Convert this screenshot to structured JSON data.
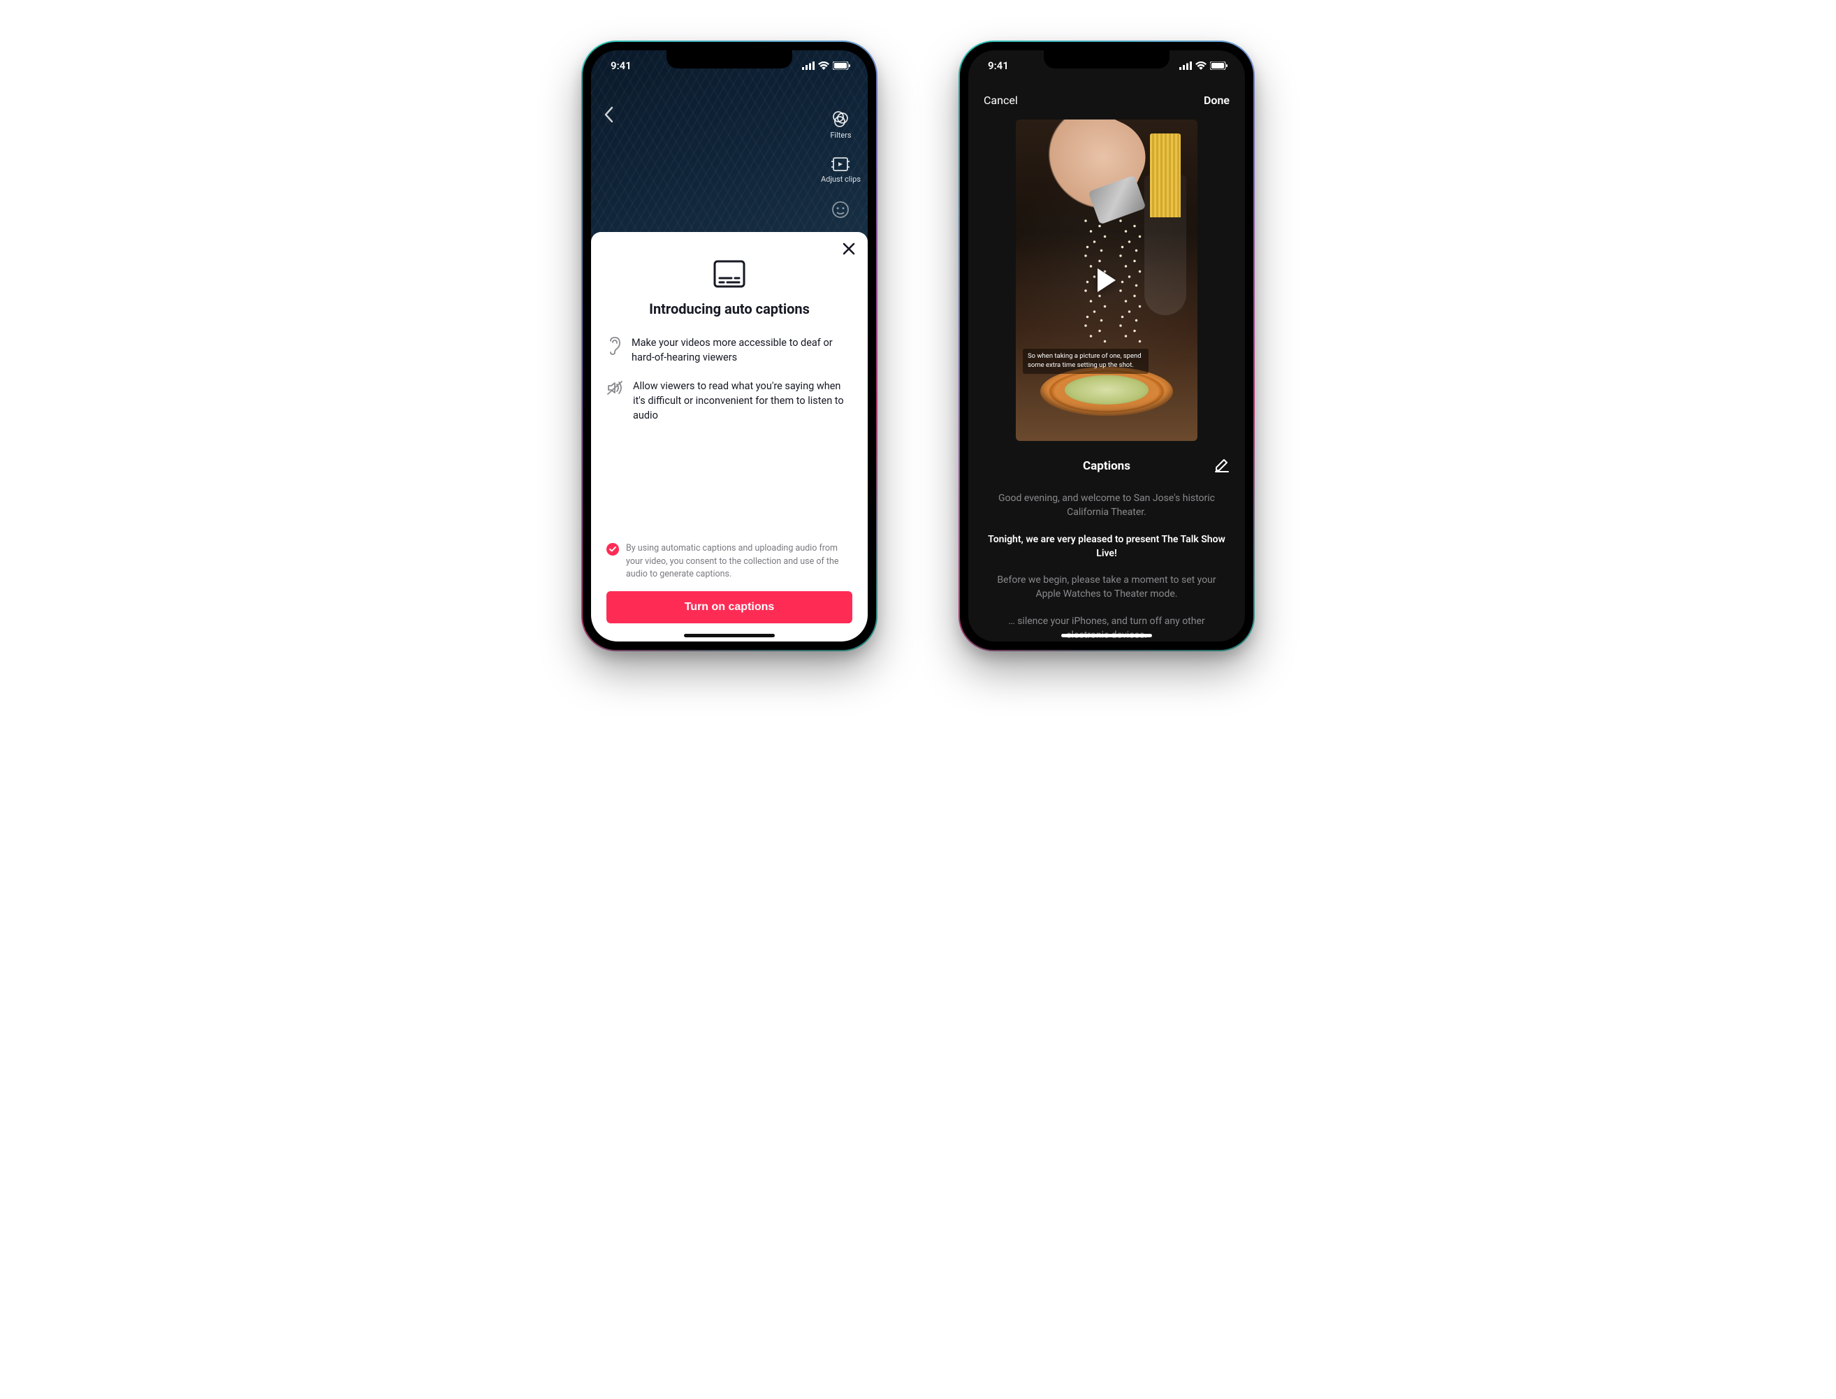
{
  "status": {
    "time": "9:41"
  },
  "phone1": {
    "back_icon": "chevron-left",
    "sidebar": [
      {
        "icon": "filters-icon",
        "label": "Filters"
      },
      {
        "icon": "adjust-clips-icon",
        "label": "Adjust clips"
      },
      {
        "icon": "voice-effects-icon",
        "label": ""
      }
    ],
    "sheet": {
      "title": "Introducing auto captions",
      "features": [
        {
          "icon": "ear-icon",
          "text": "Make your videos more accessible to deaf or hard-of-hearing viewers"
        },
        {
          "icon": "no-audio-icon",
          "text": "Allow viewers to read what you're saying when it's difficult or inconvenient for them to listen to audio"
        }
      ],
      "consent_checked": true,
      "consent_text": "By using automatic captions and uploading audio from your video, you consent to the collection and use of the audio to generate captions.",
      "cta_label": "Turn on captions"
    }
  },
  "phone2": {
    "header": {
      "cancel": "Cancel",
      "done": "Done"
    },
    "video_overlay_caption": "So when taking a picture of one, spend some extra time setting up the shot.",
    "captions_heading": "Captions",
    "transcript": [
      {
        "text": "Good evening, and welcome to San Jose's historic California Theater.",
        "active": false
      },
      {
        "text": "Tonight, we are very pleased to present The Talk Show Live!",
        "active": true
      },
      {
        "text": "Before we begin, please take a moment to set your Apple Watches to Theater mode.",
        "active": false
      },
      {
        "text": "… silence your iPhones, and turn off any other electronic devices.",
        "active": false
      }
    ]
  },
  "colors": {
    "accent": "#fe2c55"
  }
}
